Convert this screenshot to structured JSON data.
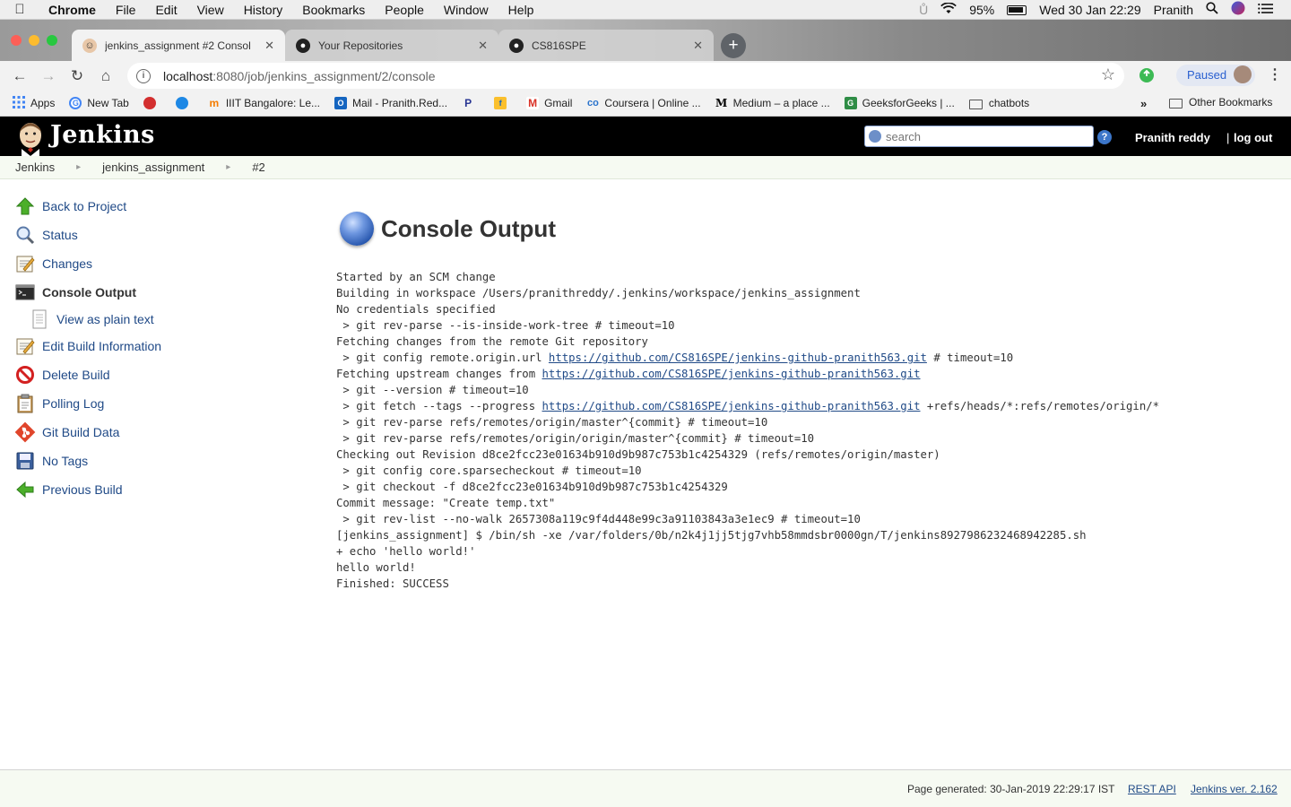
{
  "macos_menubar": {
    "app_name": "Chrome",
    "menus": [
      "File",
      "Edit",
      "View",
      "History",
      "Bookmarks",
      "People",
      "Window",
      "Help"
    ],
    "battery": "95%",
    "datetime": "Wed 30 Jan  22:29",
    "user": "Pranith"
  },
  "browser": {
    "tabs": [
      {
        "label": "jenkins_assignment #2 Consol",
        "active": true
      },
      {
        "label": "Your Repositories",
        "active": false
      },
      {
        "label": "CS816SPE",
        "active": false
      }
    ],
    "url_host": "localhost",
    "url_path": ":8080/job/jenkins_assignment/2/console",
    "profile_status": "Paused",
    "bookmarks": [
      {
        "label": "Apps",
        "icon": "apps-grid-icon",
        "color": "#4285f4"
      },
      {
        "label": "New Tab",
        "icon": "google-icon",
        "color": "#4285f4"
      },
      {
        "label": "",
        "icon": "red-circle-icon",
        "color": "#d32f2f"
      },
      {
        "label": "",
        "icon": "blue-circle-icon",
        "color": "#1e88e5"
      },
      {
        "label": "IIIT Bangalore: Le...",
        "icon": "moodle-icon",
        "color": "#f57c00"
      },
      {
        "label": "Mail - Pranith.Red...",
        "icon": "outlook-icon",
        "color": "#1565c0"
      },
      {
        "label": "",
        "icon": "paypal-icon",
        "color": "#283593"
      },
      {
        "label": "",
        "icon": "flipkart-icon",
        "color": "#fbc02d"
      },
      {
        "label": "Gmail",
        "icon": "gmail-icon",
        "color": "#d93025"
      },
      {
        "label": "Coursera | Online ...",
        "icon": "coursera-icon",
        "color": "#2a73cc"
      },
      {
        "label": "Medium – a place ...",
        "icon": "medium-icon",
        "color": "#000000"
      },
      {
        "label": "GeeksforGeeks | ...",
        "icon": "gfg-icon",
        "color": "#2f8d46"
      },
      {
        "label": "chatbots",
        "icon": "folder-icon",
        "color": "#555555"
      }
    ],
    "more_bookmarks": "»",
    "other_bookmarks": "Other Bookmarks"
  },
  "jenkins": {
    "brand": "Jenkins",
    "search_placeholder": "search",
    "user": "Pranith reddy",
    "separator": "|",
    "logout": "log out",
    "breadcrumb": [
      "Jenkins",
      "jenkins_assignment",
      "#2"
    ],
    "sidebar": [
      {
        "label": "Back to Project",
        "icon": "up-arrow-icon"
      },
      {
        "label": "Status",
        "icon": "magnifier-icon"
      },
      {
        "label": "Changes",
        "icon": "notepad-icon"
      },
      {
        "label": "Console Output",
        "icon": "terminal-icon",
        "active": true
      },
      {
        "label": "View as plain text",
        "icon": "document-icon",
        "sub": true
      },
      {
        "label": "Edit Build Information",
        "icon": "notepad-icon"
      },
      {
        "label": "Delete Build",
        "icon": "no-entry-icon"
      },
      {
        "label": "Polling Log",
        "icon": "clipboard-icon"
      },
      {
        "label": "Git Build Data",
        "icon": "git-icon"
      },
      {
        "label": "No Tags",
        "icon": "floppy-icon"
      },
      {
        "label": "Previous Build",
        "icon": "left-arrow-icon"
      }
    ],
    "page_title": "Console Output",
    "console_lines": [
      "Started by an SCM change",
      "Building in workspace /Users/pranithreddy/.jenkins/workspace/jenkins_assignment",
      "No credentials specified",
      " > git rev-parse --is-inside-work-tree # timeout=10",
      "Fetching changes from the remote Git repository",
      [
        " > git config remote.origin.url ",
        {
          "link": "https://github.com/CS816SPE/jenkins-github-pranith563.git"
        },
        " # timeout=10"
      ],
      [
        "Fetching upstream changes from ",
        {
          "link": "https://github.com/CS816SPE/jenkins-github-pranith563.git"
        }
      ],
      " > git --version # timeout=10",
      [
        " > git fetch --tags --progress ",
        {
          "link": "https://github.com/CS816SPE/jenkins-github-pranith563.git"
        },
        " +refs/heads/*:refs/remotes/origin/*"
      ],
      " > git rev-parse refs/remotes/origin/master^{commit} # timeout=10",
      " > git rev-parse refs/remotes/origin/origin/master^{commit} # timeout=10",
      "Checking out Revision d8ce2fcc23e01634b910d9b987c753b1c4254329 (refs/remotes/origin/master)",
      " > git config core.sparsecheckout # timeout=10",
      " > git checkout -f d8ce2fcc23e01634b910d9b987c753b1c4254329",
      "Commit message: \"Create temp.txt\"",
      " > git rev-list --no-walk 2657308a119c9f4d448e99c3a91103843a3e1ec9 # timeout=10",
      "[jenkins_assignment] $ /bin/sh -xe /var/folders/0b/n2k4j1jj5tjg7vhb58mmdsbr0000gn/T/jenkins8927986232468942285.sh",
      "+ echo 'hello world!'",
      "hello world!",
      "Finished: SUCCESS"
    ],
    "footer": {
      "generated": "Page generated: 30-Jan-2019 22:29:17 IST",
      "rest_api": "REST API",
      "version": "Jenkins ver. 2.162"
    }
  }
}
